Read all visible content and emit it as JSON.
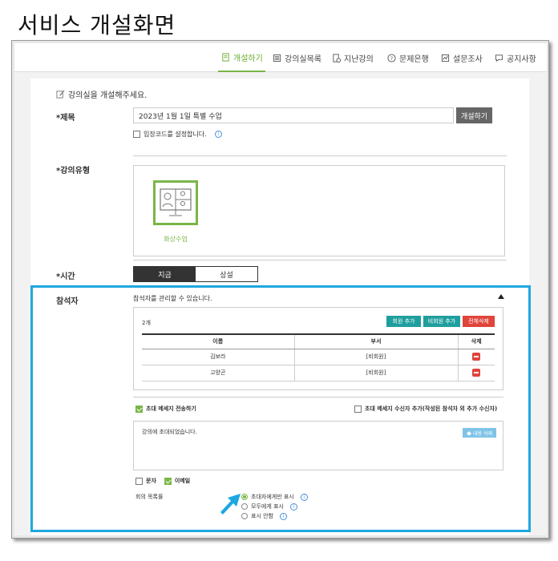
{
  "caption": "서비스 개설화면",
  "nav": {
    "tabs": [
      {
        "label": "개설하기",
        "icon": "edit-doc-icon",
        "active": true
      },
      {
        "label": "강의실목록",
        "icon": "list-icon",
        "active": false
      },
      {
        "label": "지난강의",
        "icon": "history-doc-icon",
        "active": false
      },
      {
        "label": "문제은행",
        "icon": "question-icon",
        "active": false
      },
      {
        "label": "설문조사",
        "icon": "survey-icon",
        "active": false
      },
      {
        "label": "공지사항",
        "icon": "chat-icon",
        "active": false
      }
    ]
  },
  "form": {
    "intro": "강의실을 개설해주세요.",
    "title_label": "*제목",
    "title_value": "2023년 1월 1일 특별 수업",
    "open_button": "개설하기",
    "entry_code_label": "입장코드를 설정합니다.",
    "type_label": "*강의유형",
    "type_option": "화상수업",
    "time_label": "*시간",
    "time_options": [
      "지금",
      "상설"
    ],
    "participants_label": "참석자",
    "participants_desc": "참석자를 관리할 수 있습니다.",
    "participant_count": "2개",
    "add_member_button": "회원 추가",
    "add_nonmember_button": "비회원 추가",
    "delete_all_button": "전체삭제",
    "table_headers": [
      "이름",
      "부서",
      "삭제"
    ],
    "rows": [
      {
        "name": "김보라",
        "dept": "[비회원]"
      },
      {
        "name": "고양곤",
        "dept": "[비회원]"
      }
    ],
    "send_invite_label": "초대 메세지 전송하기",
    "add_recipient_label": "초대 메세지 수신자 추가(작성된 참석자 외 추가 수신자)",
    "message_text": "강의에 초대되었습니다.",
    "message_delete_button": "내용 삭제",
    "sms_label": "문자",
    "email_label": "이메일",
    "meeting_list_label": "회의 목록률",
    "radio_options": [
      "초대자에게만 표시",
      "모두에게 표시",
      "표시 안함"
    ]
  },
  "colors": {
    "accent": "#7ab648",
    "highlight": "#1ea8e0",
    "danger": "#e0443a",
    "teal": "#1f9e9e"
  }
}
